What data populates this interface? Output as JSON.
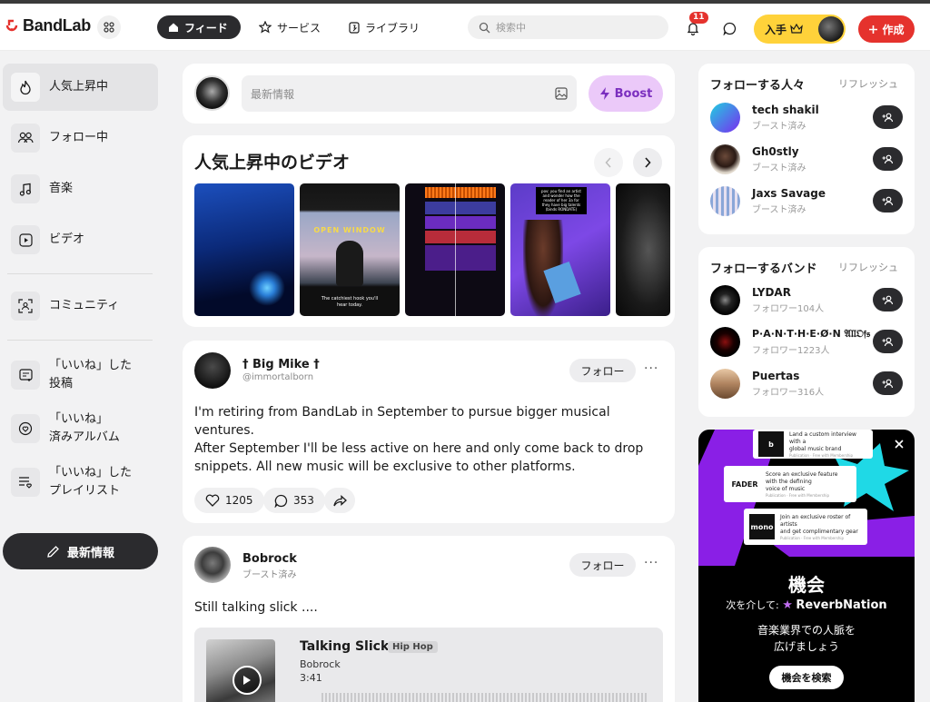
{
  "header": {
    "logo": "BandLab",
    "tabs": [
      {
        "label": "フィード",
        "active": true
      },
      {
        "label": "サービス"
      },
      {
        "label": "ライブラリ"
      }
    ],
    "search_placeholder": "検索中",
    "notification_count": "11",
    "premium_label": "入手",
    "create_label": "作成"
  },
  "sidebar": {
    "items": [
      {
        "label": "人気上昇中"
      },
      {
        "label": "フォロー中"
      },
      {
        "label": "音楽"
      },
      {
        "label": "ビデオ"
      },
      {
        "label": "コミュニティ"
      },
      {
        "line1": "「いいね」した",
        "line2": "投稿"
      },
      {
        "line1": "「いいね」",
        "line2": "済みアルバム"
      },
      {
        "line1": "「いいね」した",
        "line2": "プレイリスト"
      }
    ],
    "post_button": "最新情報"
  },
  "composer": {
    "placeholder": "最新情報",
    "boost_label": "Boost"
  },
  "trending": {
    "title": "人気上昇中のビデオ",
    "thumb2_title": "OPEN WINDOW",
    "thumb2_caption_1": "The catchiest hook you'll",
    "thumb2_caption_2": "hear today.",
    "thumb4_caption_1": "pov: you find an artist",
    "thumb4_caption_2": "and wonder how the",
    "thumb4_caption_3": "reader of her 3a for",
    "thumb4_caption_4": "they have big talents",
    "thumb4_caption_5": "(binds RONDATE)"
  },
  "posts": [
    {
      "name": "† Big Mike †",
      "handle": "@immortalborn",
      "follow": "フォロー",
      "text1": "I'm retiring from BandLab in September to pursue bigger musical ventures.",
      "text2": "After September I'll be less active on here and only come back to drop snippets. All new music will be exclusive to other platforms.",
      "likes": "1205",
      "comments": "353"
    },
    {
      "name": "Bobrock",
      "sub": "ブースト済み",
      "follow": "フォロー",
      "text": "Still talking slick ....",
      "track": {
        "title": "Talking Slick",
        "genre": "Hip Hop",
        "artist": "Bobrock",
        "duration": "3:41"
      }
    }
  ],
  "follow_people": {
    "title": "フォローする人々",
    "refresh": "リフレッシュ",
    "items": [
      {
        "name": "tech shakil",
        "sub": "ブースト済み"
      },
      {
        "name": "Gh0stly",
        "sub": "ブースト済み"
      },
      {
        "name": "Jaxs Savage",
        "sub": "ブースト済み"
      }
    ]
  },
  "follow_bands": {
    "title": "フォローするバンド",
    "refresh": "リフレッシュ",
    "items": [
      {
        "name": "LYDAR",
        "sub": "フォロワー104人"
      },
      {
        "name": "P·A·N·T·H·E·Ø·N 𝔄𝔩𝔩𝔒𝔣𝔰",
        "sub": "フォロワー1223人"
      },
      {
        "name": "Puertas",
        "sub": "フォロワー316人"
      }
    ]
  },
  "ad": {
    "card1_logo": "b",
    "card1_line1": "Land a custom interview with a",
    "card1_line2": "global music brand",
    "card1_meta": "Publication · Free with Membership",
    "card2_logo": "FADER",
    "card2_line1": "Score an exclusive feature with the defining",
    "card2_line2": "voice of music",
    "card2_meta": "Publication · Free with Membership",
    "card3_logo": "mono",
    "card3_line1": "Join an exclusive roster of artists",
    "card3_line2": "and get complimentary gear",
    "card3_meta": "Publication · Free with Membership",
    "headline": "機会",
    "via": "次を介して:",
    "brand": "ReverbNation",
    "body1": "音楽業界での人脈を",
    "body2": "広げましょう",
    "cta": "機会を検索"
  },
  "colors": {
    "accent_red": "#e5322d",
    "boost_purple": "#ebc9f9",
    "premium_yellow": "#ffd23a",
    "dark": "#2b2b2e"
  }
}
